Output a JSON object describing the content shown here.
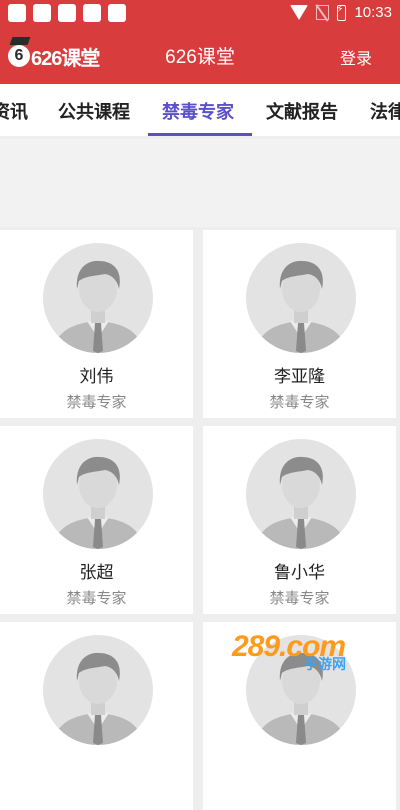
{
  "status_bar": {
    "time": "10:33"
  },
  "app_bar": {
    "logo_text": "626课堂",
    "logo_number": "6",
    "title": "626课堂",
    "login_label": "登录"
  },
  "tabs": [
    {
      "label": "资讯"
    },
    {
      "label": "公共课程"
    },
    {
      "label": "禁毒专家"
    },
    {
      "label": "文献报告"
    },
    {
      "label": "法律"
    }
  ],
  "active_tab": "禁毒专家",
  "experts": [
    {
      "name": "刘伟",
      "role": "禁毒专家"
    },
    {
      "name": "李亚隆",
      "role": "禁毒专家"
    },
    {
      "name": "张超",
      "role": "禁毒专家"
    },
    {
      "name": "鲁小华",
      "role": "禁毒专家"
    },
    {
      "name": "",
      "role": ""
    },
    {
      "name": "",
      "role": ""
    }
  ],
  "watermark": {
    "main": "289.com",
    "sub": "手游网"
  },
  "colors": {
    "brand_red": "#d93c3c",
    "accent_purple": "#5b50c8",
    "role_gray": "#888888"
  }
}
